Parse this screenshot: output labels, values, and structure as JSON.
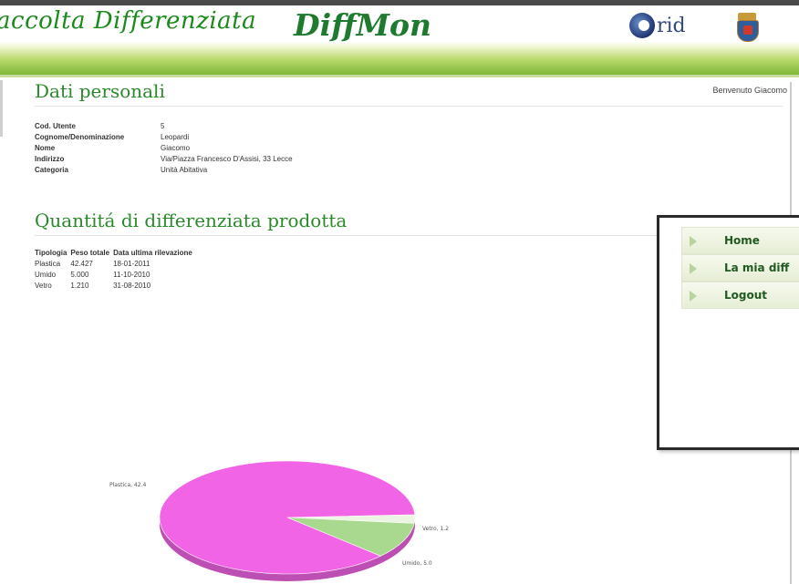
{
  "header": {
    "title": "accolta Differenziata",
    "logo": "DiffMon",
    "grid_logo": "rid"
  },
  "welcome": "Benvenuto Giacomo",
  "personal": {
    "title": "Dati personali",
    "rows": [
      {
        "label": "Cod. Utente",
        "value": "5"
      },
      {
        "label": "Cognome/Denominazione",
        "value": "Leopardi"
      },
      {
        "label": "Nome",
        "value": "Giacomo"
      },
      {
        "label": "Indirizzo",
        "value": "Via/Piazza Francesco D'Assisi, 33 Lecce"
      },
      {
        "label": "Categoria",
        "value": "Unità Abitativa"
      }
    ]
  },
  "quantity": {
    "title": "Quantitá di differenziata prodotta",
    "columns": [
      "Tipologia",
      "Peso totale",
      "Data ultima rilevazione"
    ],
    "rows": [
      [
        "Plastica",
        "42.427",
        "18-01-2011"
      ],
      [
        "Umido",
        "5.000",
        "11-10-2010"
      ],
      [
        "Vetro",
        "1.210",
        "31-08-2010"
      ]
    ]
  },
  "menu": {
    "items": [
      {
        "label": "Home"
      },
      {
        "label": "La mia diff"
      },
      {
        "label": "Logout"
      }
    ]
  },
  "chart_data": {
    "type": "pie",
    "slices": [
      {
        "label": "Plastica, 42.4",
        "value": 42.4,
        "color": "#f264e6"
      },
      {
        "label": "Vetro, 1.2",
        "value": 1.2,
        "color": "#ecf4e2"
      },
      {
        "label": "Umido, 5.0",
        "value": 5.0,
        "color": "#a9d98f"
      }
    ]
  },
  "colors": {
    "accent_green": "#2a8a2a",
    "header_gradient_end": "#7fb83a"
  }
}
